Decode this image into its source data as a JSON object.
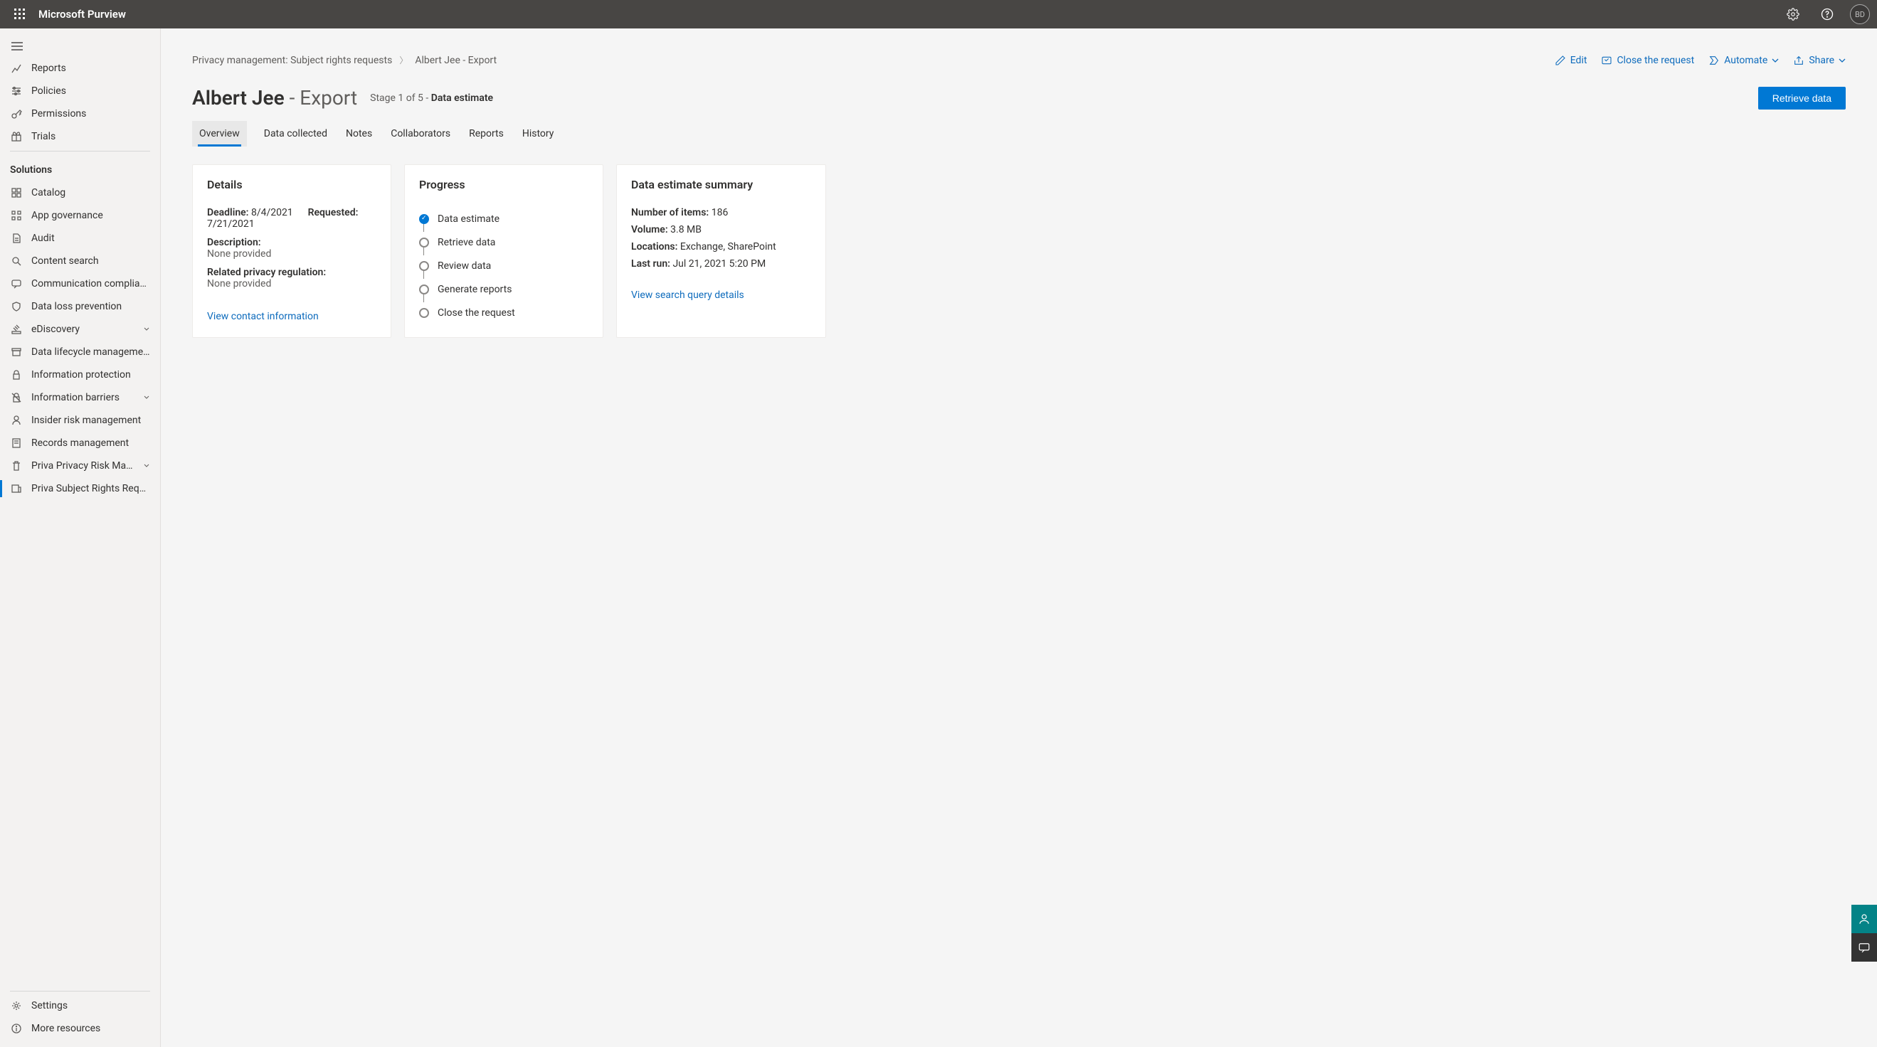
{
  "header": {
    "brand": "Microsoft Purview",
    "avatar_initials": "BD"
  },
  "sidebar": {
    "items_top": [
      {
        "label": "Reports",
        "icon": "chart"
      },
      {
        "label": "Policies",
        "icon": "sliders"
      },
      {
        "label": "Permissions",
        "icon": "key"
      },
      {
        "label": "Trials",
        "icon": "gift"
      }
    ],
    "section_label": "Solutions",
    "items_solutions": [
      {
        "label": "Catalog",
        "icon": "grid"
      },
      {
        "label": "App governance",
        "icon": "apps"
      },
      {
        "label": "Audit",
        "icon": "doc"
      },
      {
        "label": "Content search",
        "icon": "search"
      },
      {
        "label": "Communication compliance",
        "icon": "chat"
      },
      {
        "label": "Data loss prevention",
        "icon": "shield"
      },
      {
        "label": "eDiscovery",
        "icon": "gavel",
        "expandable": true
      },
      {
        "label": "Data lifecycle management",
        "icon": "archive"
      },
      {
        "label": "Information protection",
        "icon": "lock"
      },
      {
        "label": "Information barriers",
        "icon": "barrier",
        "expandable": true
      },
      {
        "label": "Insider risk management",
        "icon": "person"
      },
      {
        "label": "Records management",
        "icon": "records"
      },
      {
        "label": "Priva Privacy Risk Managem…",
        "icon": "trash",
        "expandable": true
      },
      {
        "label": "Priva Subject Rights Requests",
        "icon": "request",
        "selected": true
      }
    ],
    "items_bottom": [
      {
        "label": "Settings",
        "icon": "gear"
      },
      {
        "label": "More resources",
        "icon": "info"
      }
    ]
  },
  "breadcrumb": {
    "root": "Privacy management: Subject rights requests",
    "current": "Albert Jee - Export"
  },
  "actions": {
    "edit": "Edit",
    "close_request": "Close the request",
    "automate": "Automate",
    "share": "Share"
  },
  "title": {
    "name": "Albert Jee",
    "suffix": "Export",
    "stage_prefix": "Stage 1 of 5 -",
    "stage_name": "Data estimate",
    "primary_button": "Retrieve data"
  },
  "tabs": [
    "Overview",
    "Data collected",
    "Notes",
    "Collaborators",
    "Reports",
    "History"
  ],
  "details": {
    "heading": "Details",
    "deadline_label": "Deadline:",
    "deadline_value": "8/4/2021",
    "requested_label": "Requested:",
    "requested_value": "7/21/2021",
    "description_label": "Description:",
    "description_value": "None provided",
    "regulation_label": "Related privacy regulation:",
    "regulation_value": "None provided",
    "contact_link": "View contact information"
  },
  "progress": {
    "heading": "Progress",
    "steps": [
      {
        "label": "Data estimate",
        "done": true
      },
      {
        "label": "Retrieve data",
        "done": false
      },
      {
        "label": "Review data",
        "done": false
      },
      {
        "label": "Generate reports",
        "done": false
      },
      {
        "label": "Close the request",
        "done": false
      }
    ]
  },
  "summary": {
    "heading": "Data estimate summary",
    "items_label": "Number of items:",
    "items_value": "186",
    "volume_label": "Volume:",
    "volume_value": "3.8 MB",
    "locations_label": "Locations:",
    "locations_value": "Exchange, SharePoint",
    "lastrun_label": "Last run:",
    "lastrun_value": "Jul 21, 2021 5:20 PM",
    "query_link": "View search query details"
  }
}
